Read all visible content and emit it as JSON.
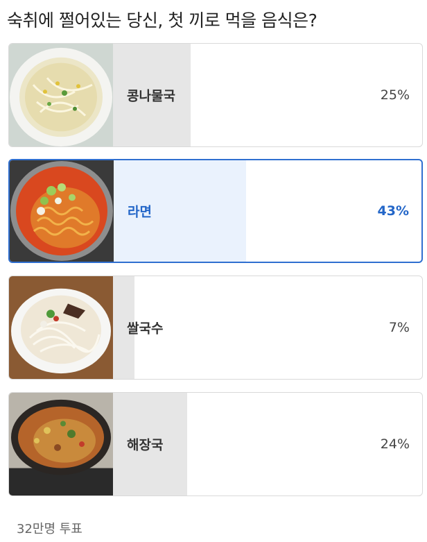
{
  "poll": {
    "question": "숙취에 쩔어있는 당신, 첫 끼로 먹을 음식은?",
    "total_votes": "32만명 투표",
    "options": [
      {
        "label": "콩나물국",
        "percent": "25%",
        "value": 25,
        "selected": false
      },
      {
        "label": "라면",
        "percent": "43%",
        "value": 43,
        "selected": true
      },
      {
        "label": "쌀국수",
        "percent": "7%",
        "value": 7,
        "selected": false
      },
      {
        "label": "해장국",
        "percent": "24%",
        "value": 24,
        "selected": false
      }
    ]
  },
  "colors": {
    "accent": "#2f6fd0",
    "bar": "#e6e6e6",
    "bar_selected": "#eaf2fd"
  },
  "icons": [
    "bean-sprout-soup-image",
    "ramen-image",
    "pho-image",
    "hangover-soup-image"
  ]
}
